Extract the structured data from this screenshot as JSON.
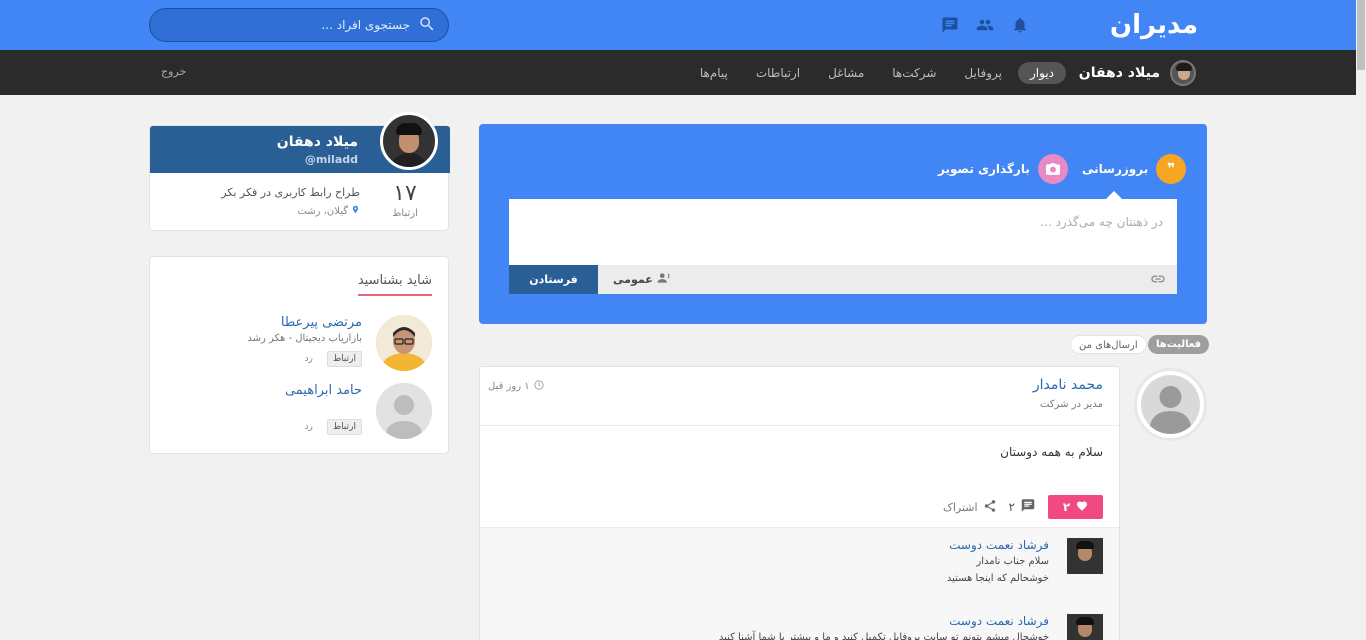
{
  "colors": {
    "brand_blue": "#4285f4",
    "dark_nav": "#2b2b2b",
    "profile_header": "#2a5f95",
    "like_pink": "#f24a80",
    "update_icon": "#f5a623",
    "image_icon": "#e88ac6",
    "suggest_underline": "#e8667a"
  },
  "header": {
    "logo_text": "مدیران",
    "search_placeholder": "جستجوی افراد ...",
    "icons": [
      "notification-bell-icon",
      "people-icon",
      "chat-icon",
      "search-icon"
    ]
  },
  "nav": {
    "username": "میلاد دهقان",
    "items": [
      {
        "label": "دیوار",
        "active": true
      },
      {
        "label": "پروفایل",
        "active": false
      },
      {
        "label": "شرکت‌ها",
        "active": false
      },
      {
        "label": "مشاغل",
        "active": false
      },
      {
        "label": "ارتباطات",
        "active": false
      },
      {
        "label": "پیام‌ها",
        "active": false
      }
    ],
    "logout": "خروج"
  },
  "profile": {
    "name": "میلاد دهقان",
    "handle": "@miladd",
    "connections_count": "۱۷",
    "connections_label": "ارتباط",
    "description": "طراح رابط کاربری در فکر بکر",
    "location": "گیلان، رشت"
  },
  "suggestions": {
    "title": "شاید بشناسید",
    "people": [
      {
        "name": "مرتضی پیرعطا",
        "subtitle": "بازاریاب دیجیتال - هکر رشد",
        "connect": "ارتباط",
        "reject": "رد"
      },
      {
        "name": "حامد ابراهیمی",
        "subtitle": "",
        "connect": "ارتباط",
        "reject": "رد"
      }
    ]
  },
  "composer": {
    "tab_update": "بروزرسانی",
    "tab_image": "بارگذاری تصویر",
    "placeholder": "در ذهنتان چه می‌گذرد ...",
    "privacy": "عمومی",
    "send": "فرستادن"
  },
  "filters": {
    "activities": "فعالیت‌ها",
    "my_posts": "ارسال‌های من"
  },
  "post": {
    "author": "محمد نامدار",
    "role": "مدیر در شرکت",
    "time": "۱ روز قبل",
    "body": "سلام به همه دوستان",
    "likes": "۲",
    "comments_count": "۲",
    "share": "اشتراک",
    "comments": [
      {
        "name": "فرشاد نعمت دوست",
        "lines": [
          "سلام جناب نامدار",
          "خوشحالم که اینجا هستید"
        ]
      },
      {
        "name": "فرشاد نعمت دوست",
        "lines": [
          "خوشحال میشم بتونم تو سایت پروفایل تکمیل کنید و ما و بیشتر با شما آشنا کنید"
        ]
      }
    ]
  }
}
